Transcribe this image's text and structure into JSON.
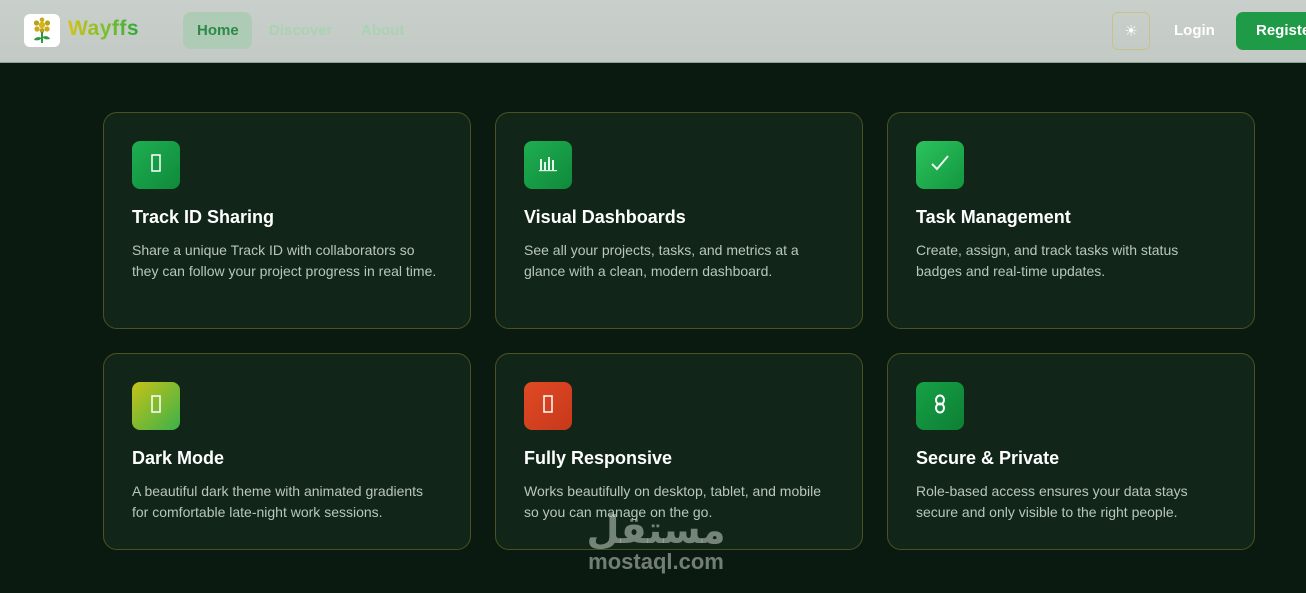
{
  "nav": {
    "brand": "Wayffs",
    "links": [
      {
        "label": "Home",
        "active": true
      },
      {
        "label": "Discover",
        "active": false
      },
      {
        "label": "About",
        "active": false
      }
    ],
    "theme_toggle_icon": "sun-icon",
    "theme_toggle_glyph": "☀",
    "login_label": "Login",
    "register_label": "Register"
  },
  "features": [
    {
      "title": "Track ID Sharing",
      "description": "Share a unique Track ID with collaborators so they can follow your project progress in real time.",
      "icon": "link-icon",
      "color": "#17a34a"
    },
    {
      "title": "Visual Dashboards",
      "description": "See all your projects, tasks, and metrics at a glance with a clean, modern dashboard.",
      "icon": "bar-chart-icon",
      "color": "#17a34a"
    },
    {
      "title": "Task Management",
      "description": "Create, assign, and track tasks with status badges and real-time updates.",
      "icon": "check-icon",
      "color": "#22b455"
    },
    {
      "title": "Dark Mode",
      "description": "A beautiful dark theme with animated gradients for comfortable late-night work sessions.",
      "icon": "moon-icon",
      "color": "#a8c51a"
    },
    {
      "title": "Fully Responsive",
      "description": "Works beautifully on desktop, tablet, and mobile so you can manage on the go.",
      "icon": "mobile-icon",
      "color": "#d8401f"
    },
    {
      "title": "Secure & Private",
      "description": "Role-based access ensures your data stays secure and only visible to the right people.",
      "icon": "lock-icon",
      "color": "#14913e"
    }
  ],
  "watermark": {
    "arabic": "مستقل",
    "latin": "mostaql.com"
  }
}
